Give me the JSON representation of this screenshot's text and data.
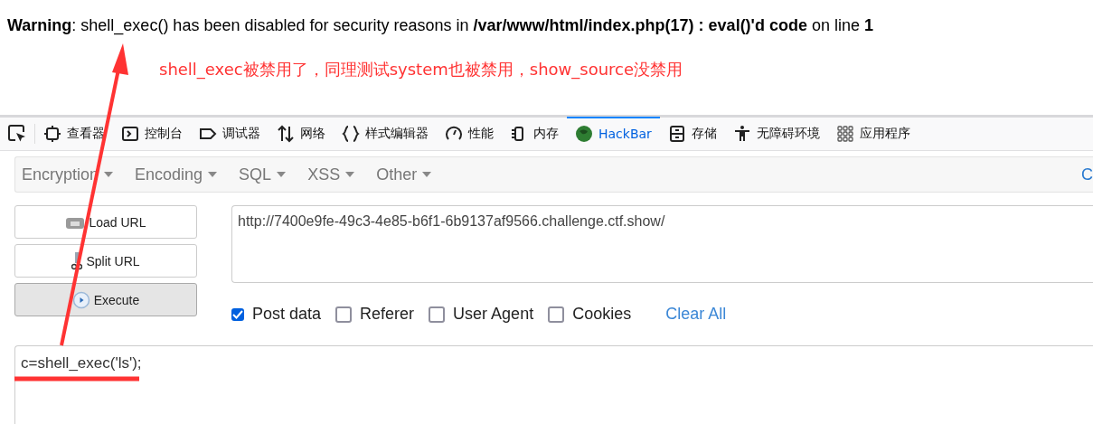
{
  "warning": {
    "label": "Warning",
    "message": ": shell_exec() has been disabled for security reasons in **/var/www/html/index.php(17) : eval()'d code** on line **1**"
  },
  "annotation": {
    "note": "shell_exec被禁用了，同理测试system也被禁用，show_source没禁用"
  },
  "devtools_tabs": [
    {
      "label": "查看器",
      "kind": "inspector",
      "selected": false
    },
    {
      "label": "控制台",
      "kind": "console",
      "selected": false
    },
    {
      "label": "调试器",
      "kind": "debugger",
      "selected": false
    },
    {
      "label": "网络",
      "kind": "network",
      "selected": false
    },
    {
      "label": "样式编辑器",
      "kind": "style",
      "selected": false
    },
    {
      "label": "性能",
      "kind": "performance",
      "selected": false
    },
    {
      "label": "内存",
      "kind": "memory",
      "selected": false
    },
    {
      "label": "HackBar",
      "kind": "hackbar",
      "selected": true
    },
    {
      "label": "存储",
      "kind": "storage",
      "selected": false
    },
    {
      "label": "无障碍环境",
      "kind": "accessibility",
      "selected": false
    },
    {
      "label": "应用程序",
      "kind": "apps",
      "selected": false
    }
  ],
  "hackbar_menu": [
    "Encryption",
    "Encoding",
    "SQL",
    "XSS",
    "Other"
  ],
  "menu_cut_item": "C",
  "buttons": [
    {
      "label": "Load URL",
      "kind": "load"
    },
    {
      "label": "Split URL",
      "kind": "split"
    },
    {
      "label": "Execute",
      "kind": "execute"
    }
  ],
  "url": {
    "value": "http://7400e9fe-49c3-4e85-b6f1-6b9137af9566.challenge.ctf.show/"
  },
  "options": [
    {
      "label": "Post data",
      "checked": true
    },
    {
      "label": "Referer",
      "checked": false
    },
    {
      "label": "User Agent",
      "checked": false
    },
    {
      "label": "Cookies",
      "checked": false
    }
  ],
  "clear_all": "Clear All",
  "post_body": {
    "value": "c=shell_exec('ls');"
  }
}
